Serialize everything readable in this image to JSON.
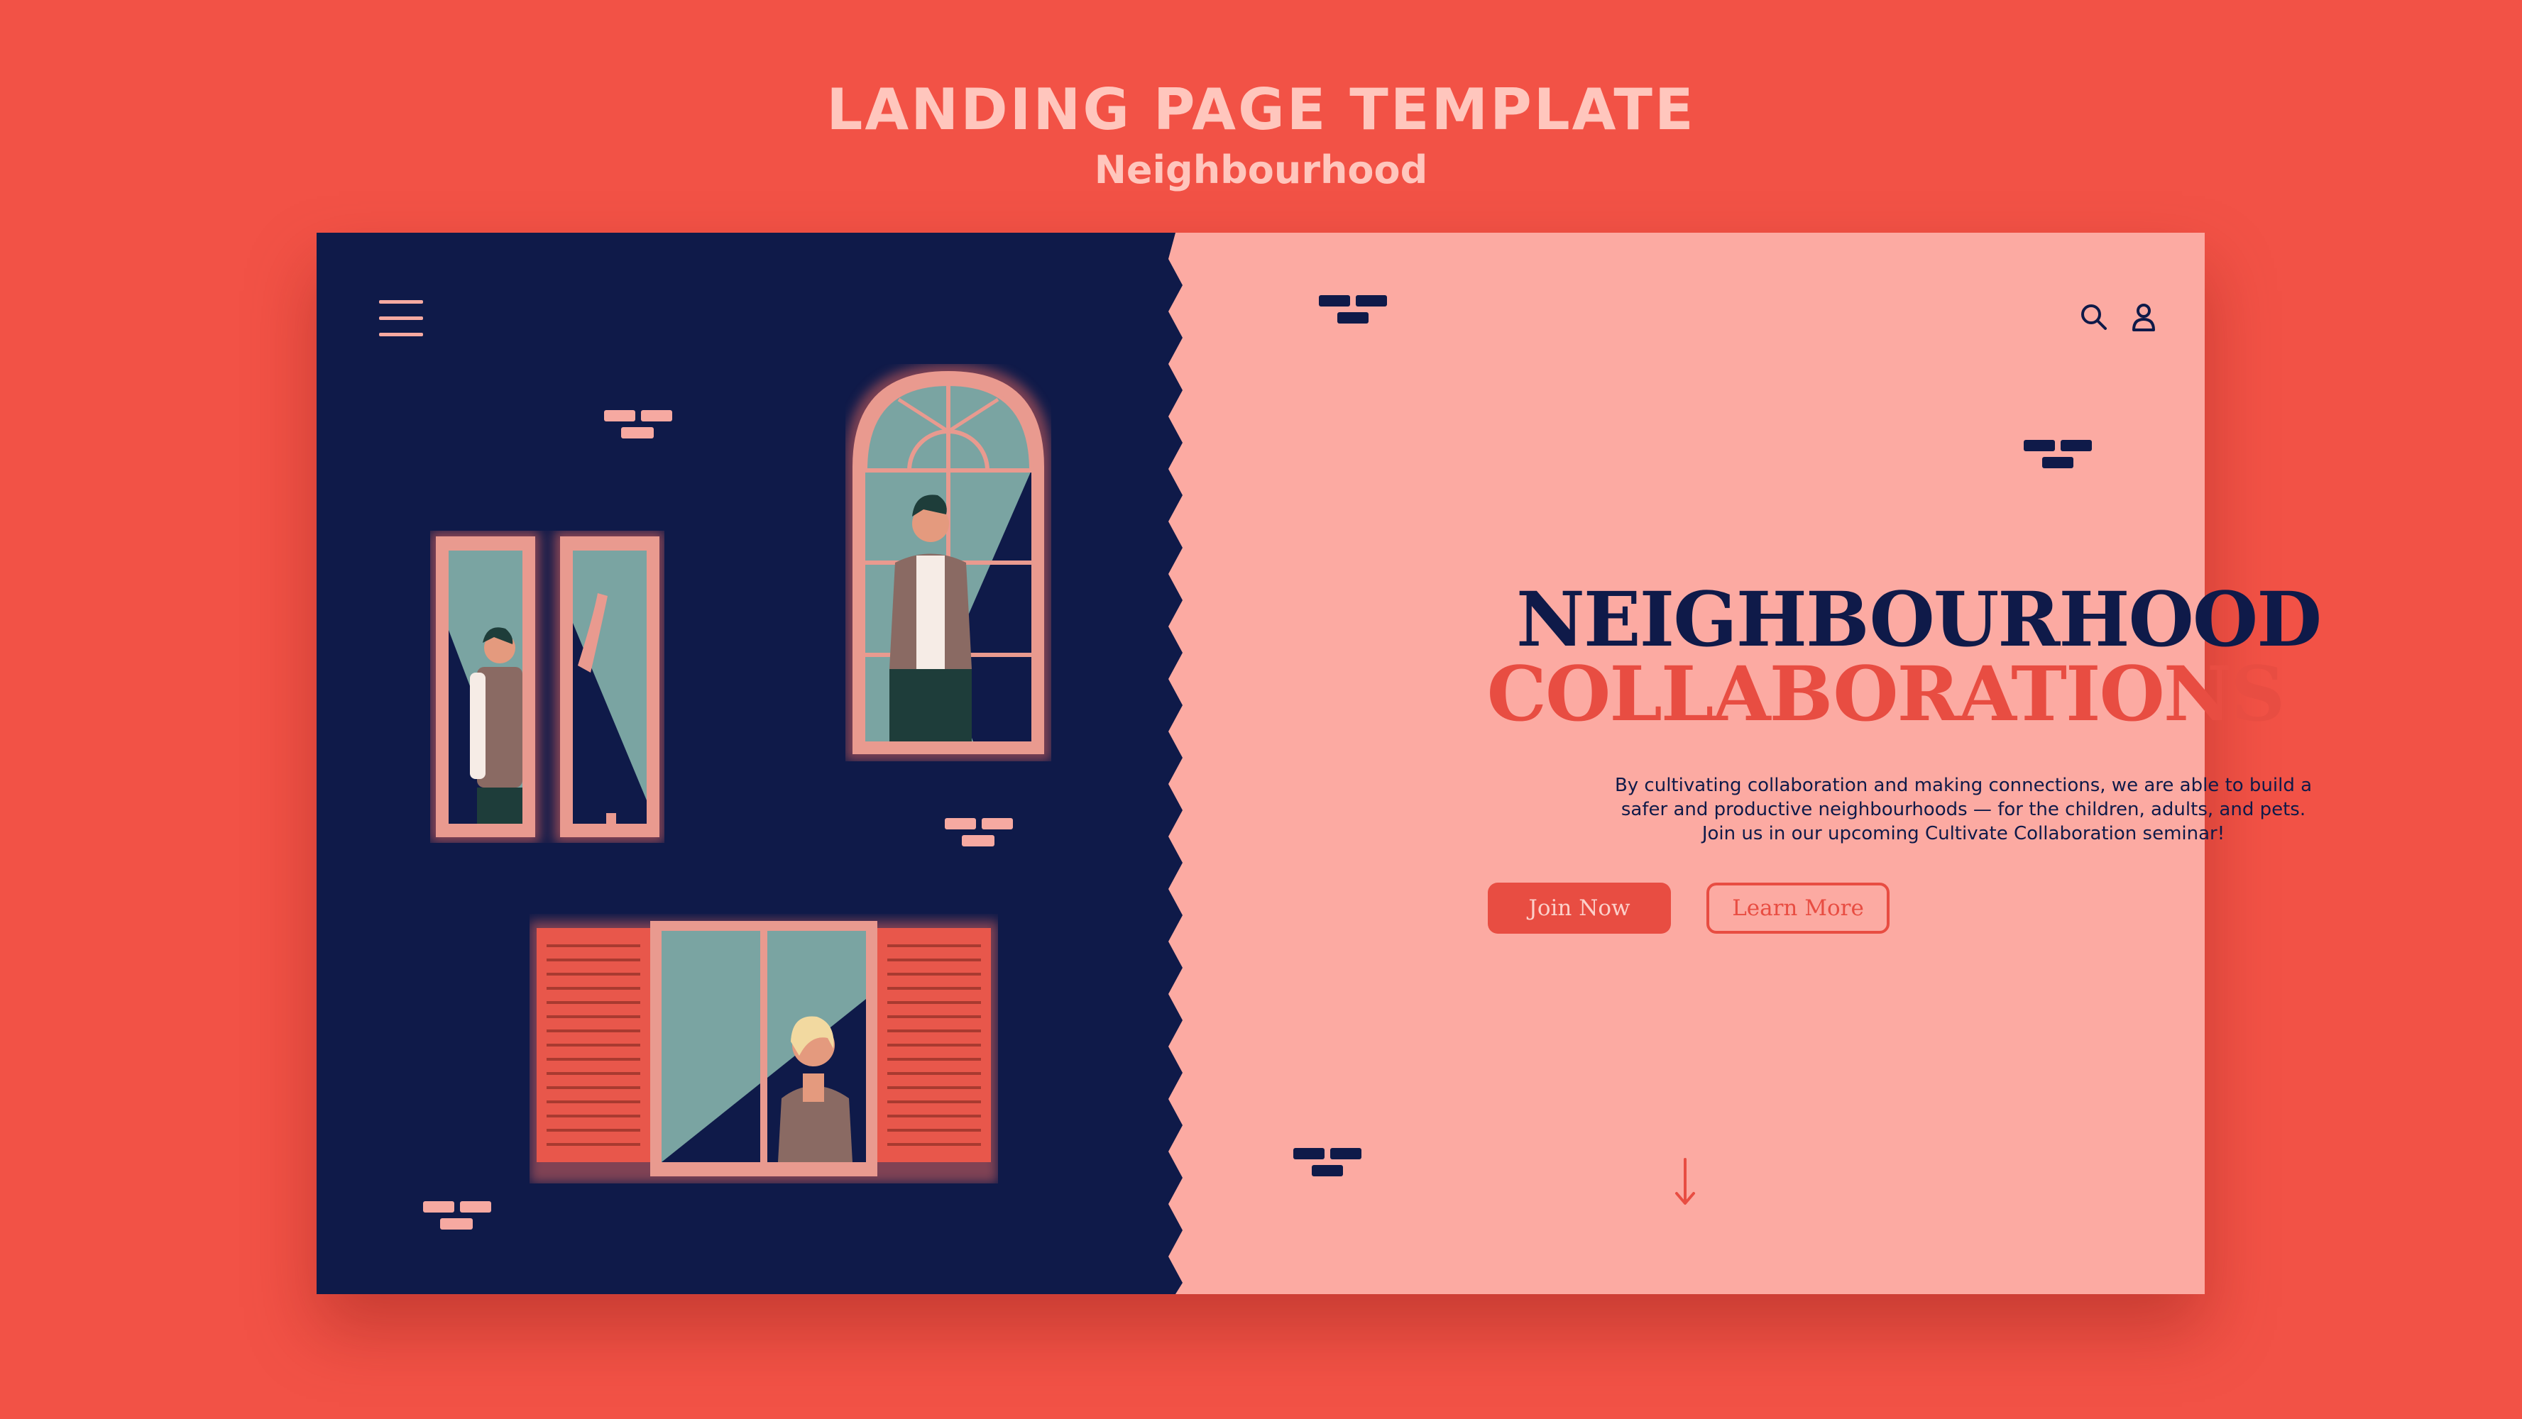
{
  "header": {
    "title": "LANDING PAGE TEMPLATE",
    "subtitle": "Neighbourhood"
  },
  "hero": {
    "title_line1": "NEIGHBOURHOOD",
    "title_line2": "COLLABORATIONS",
    "description": "By cultivating collaboration and making connections, we are able to build a safer and productive neighbourhoods — for the children, adults, and pets. Join us in our upcoming Cultivate Collaboration seminar!",
    "join_label": "Join Now",
    "learn_label": "Learn More"
  },
  "icons": {
    "menu": "menu-icon",
    "search": "search-icon",
    "user": "user-icon",
    "scroll": "arrow-down-icon"
  },
  "colors": {
    "background": "#f25246",
    "navy": "#0f1a49",
    "pink": "#fcaaa2",
    "accent": "#e84d42",
    "header_text": "#ffc6bd"
  }
}
